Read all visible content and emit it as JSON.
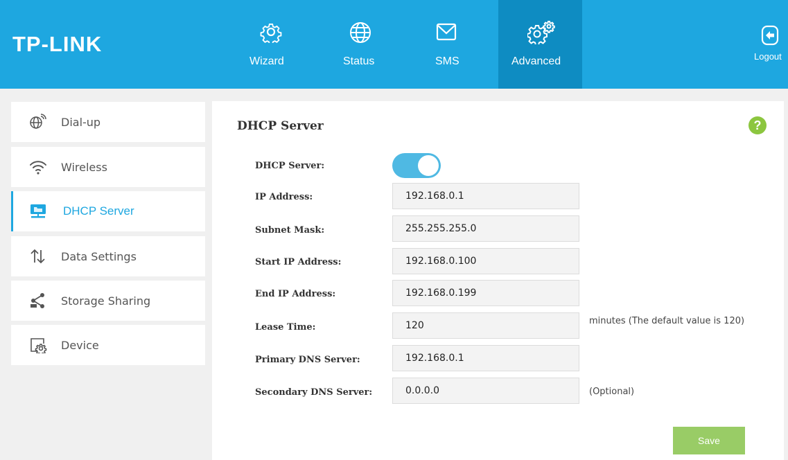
{
  "brand": {
    "logo_text": "TP-LINK",
    "primary_color": "#1ea7e0",
    "accent_green": "#8cc63f"
  },
  "nav": {
    "items": [
      {
        "label": "Wizard",
        "icon": "gear-icon"
      },
      {
        "label": "Status",
        "icon": "globe-icon"
      },
      {
        "label": "SMS",
        "icon": "envelope-icon"
      },
      {
        "label": "Advanced",
        "icon": "gears-icon",
        "active": true
      }
    ],
    "logout_label": "Logout"
  },
  "sidebar": {
    "items": [
      {
        "label": "Dial-up",
        "icon": "globe-signal-icon"
      },
      {
        "label": "Wireless",
        "icon": "wifi-icon"
      },
      {
        "label": "DHCP Server",
        "icon": "dhcp-server-icon",
        "active": true
      },
      {
        "label": "Data Settings",
        "icon": "up-down-arrows-icon"
      },
      {
        "label": "Storage Sharing",
        "icon": "share-icon"
      },
      {
        "label": "Device",
        "icon": "device-settings-icon"
      }
    ]
  },
  "main": {
    "title": "DHCP Server",
    "help_label": "?",
    "fields": {
      "dhcp_server": {
        "label": "DHCP Server:",
        "enabled": true
      },
      "ip_address": {
        "label": "IP Address:",
        "value": "192.168.0.1"
      },
      "subnet_mask": {
        "label": "Subnet Mask:",
        "value": "255.255.255.0"
      },
      "start_ip": {
        "label": "Start IP Address:",
        "value": "192.168.0.100"
      },
      "end_ip": {
        "label": "End IP Address:",
        "value": "192.168.0.199"
      },
      "lease_time": {
        "label": "Lease Time:",
        "value": "120",
        "note": "minutes (The default value is 120)"
      },
      "primary_dns": {
        "label": "Primary DNS Server:",
        "value": "192.168.0.1"
      },
      "secondary_dns": {
        "label": "Secondary DNS Server:",
        "value": "0.0.0.0",
        "note": "(Optional)"
      }
    },
    "save_label": "Save"
  }
}
